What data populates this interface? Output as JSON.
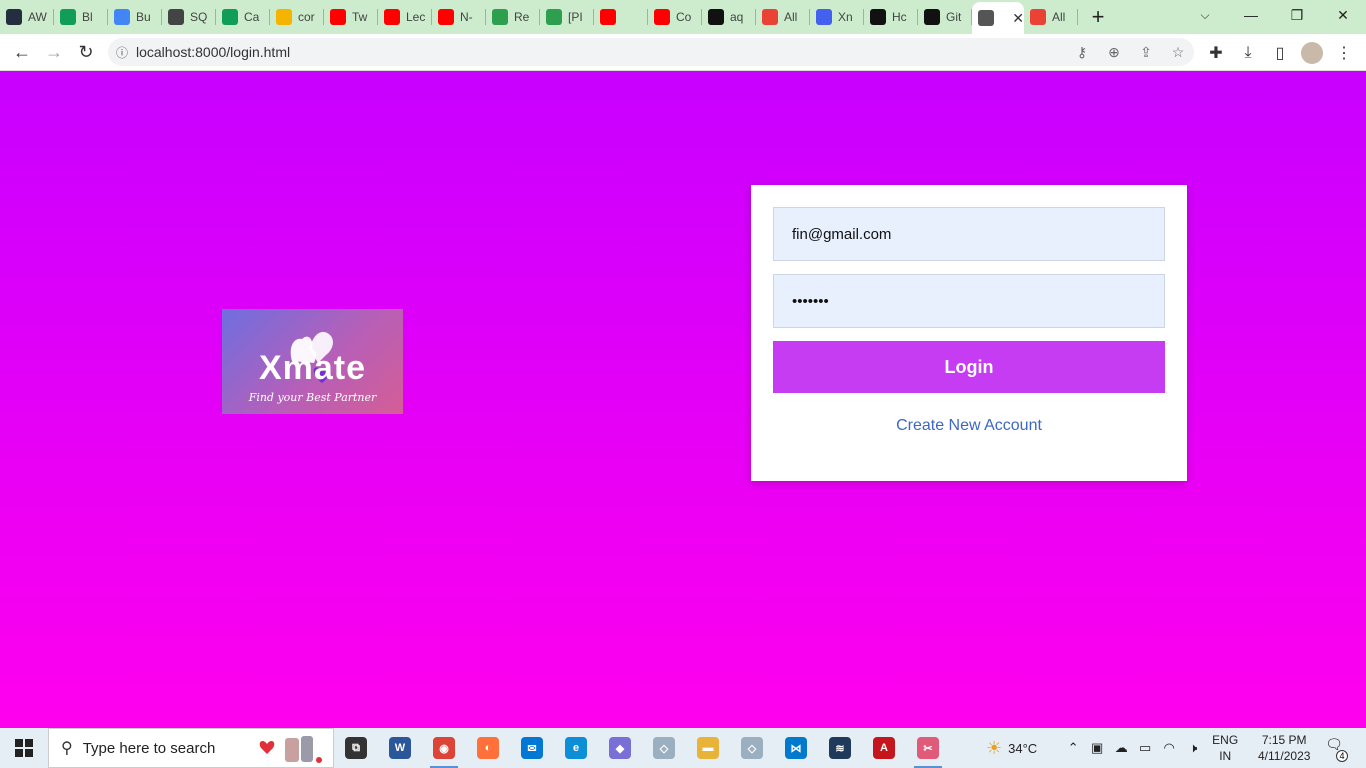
{
  "browser": {
    "tabs": [
      {
        "title": "AW",
        "icon": "aws-icon",
        "color": "#232f3e"
      },
      {
        "title": "Bl",
        "icon": "sheets-icon",
        "color": "#0f9d58"
      },
      {
        "title": "Bu",
        "icon": "cloud-icon",
        "color": "#4285f4"
      },
      {
        "title": "SQ",
        "icon": "doc-icon",
        "color": "#444444"
      },
      {
        "title": "Ca",
        "icon": "sheets-icon",
        "color": "#0f9d58"
      },
      {
        "title": "cor",
        "icon": "drive-icon",
        "color": "#f4b400"
      },
      {
        "title": "Tw",
        "icon": "youtube-icon",
        "color": "#ff0000"
      },
      {
        "title": "Lec",
        "icon": "youtube-icon",
        "color": "#ff0000"
      },
      {
        "title": "N-",
        "icon": "youtube-icon",
        "color": "#ff0000"
      },
      {
        "title": "Re",
        "icon": "leaf-icon",
        "color": "#2e9e4f"
      },
      {
        "title": "[PI",
        "icon": "leaf-icon",
        "color": "#2e9e4f"
      },
      {
        "title": "",
        "icon": "youtube-emoji-icon",
        "color": "#ff0000"
      },
      {
        "title": "Co",
        "icon": "youtube-icon",
        "color": "#ff0000"
      },
      {
        "title": "aq",
        "icon": "github-icon",
        "color": "#111111"
      },
      {
        "title": "All",
        "icon": "gmail-icon",
        "color": "#ea4335"
      },
      {
        "title": "Xn",
        "icon": "docs-icon",
        "color": "#4361ee"
      },
      {
        "title": "Hc",
        "icon": "chat-icon",
        "color": "#111111"
      },
      {
        "title": "Git",
        "icon": "github-icon",
        "color": "#111111"
      }
    ],
    "active_tab": {
      "title": "",
      "icon": "globe-icon",
      "color": "#555555"
    },
    "last_tab": {
      "title": "All",
      "icon": "gmail-icon",
      "color": "#ea4335"
    },
    "url": "localhost:8000/login.html"
  },
  "page": {
    "background_top": "#c800ff",
    "background_bottom": "#ff00ee",
    "logo": {
      "name": "Xmate",
      "tagline": "Find your Best Partner"
    },
    "form": {
      "email_value": "fin@gmail.com",
      "password_value": "•••••••",
      "login_label": "Login",
      "create_account_label": "Create New Account",
      "button_color": "#c53cf3",
      "link_color": "#3d67c7"
    }
  },
  "taskbar": {
    "search_placeholder": "Type here to search",
    "apps": [
      {
        "name": "task-view-icon",
        "color": "#333333",
        "glyph": "⧉",
        "running": false
      },
      {
        "name": "word-icon",
        "color": "#2b579a",
        "glyph": "W",
        "running": false
      },
      {
        "name": "chrome-icon",
        "color": "#db4437",
        "glyph": "◉",
        "running": true
      },
      {
        "name": "firefox-icon",
        "color": "#ff7139",
        "glyph": "◐",
        "running": false
      },
      {
        "name": "mail-icon",
        "color": "#0078d4",
        "glyph": "✉",
        "running": false
      },
      {
        "name": "edge-icon",
        "color": "#0c8fd6",
        "glyph": "e",
        "running": false
      },
      {
        "name": "copilot-icon",
        "color": "#7a6fd6",
        "glyph": "◆",
        "running": false
      },
      {
        "name": "diamond-app-icon",
        "color": "#9ab0c0",
        "glyph": "◇",
        "running": false
      },
      {
        "name": "file-explorer-icon",
        "color": "#e8b339",
        "glyph": "▬",
        "running": false
      },
      {
        "name": "diamond-app-icon",
        "color": "#9ab0c0",
        "glyph": "◇",
        "running": false
      },
      {
        "name": "vscode-icon",
        "color": "#007acc",
        "glyph": "⋈",
        "running": false
      },
      {
        "name": "mysql-workbench-icon",
        "color": "#1f3a5a",
        "glyph": "≋",
        "running": false
      },
      {
        "name": "acrobat-icon",
        "color": "#c4161c",
        "glyph": "A",
        "running": false
      },
      {
        "name": "snipping-tool-icon",
        "color": "#e05a7a",
        "glyph": "✂",
        "running": true
      }
    ],
    "weather": "34°C",
    "lang_line1": "ENG",
    "lang_line2": "IN",
    "time": "7:15 PM",
    "date": "4/11/2023",
    "notification_count": "4"
  }
}
